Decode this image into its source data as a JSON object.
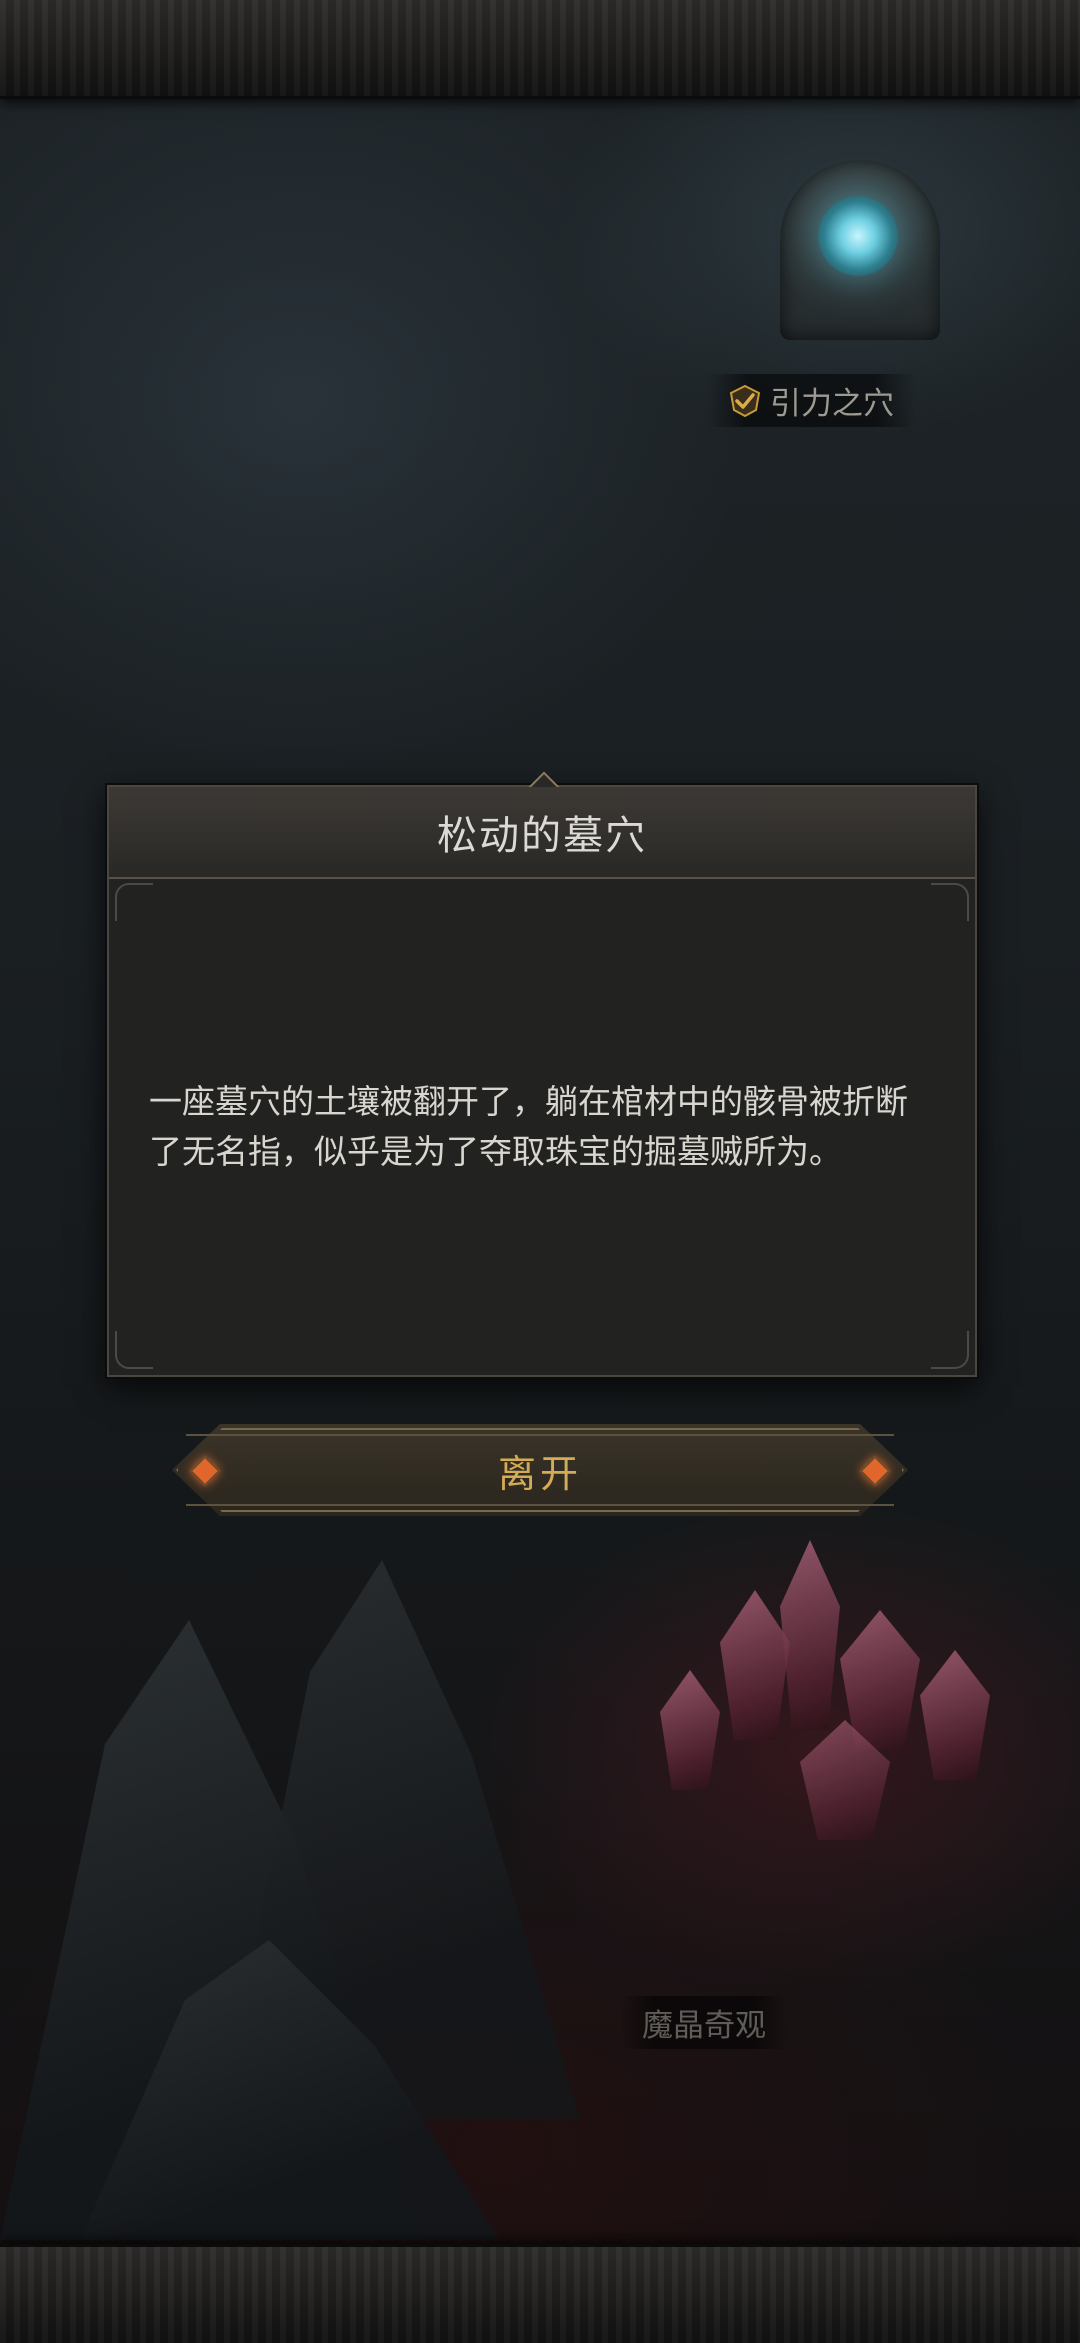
{
  "locations": {
    "gravity_hole": "引力之穴",
    "crystal_wonder": "魔晶奇观"
  },
  "dialog": {
    "title": "松动的墓穴",
    "body": "一座墓穴的土壤被翻开了，躺在棺材中的骸骨被折断了无名指，似乎是为了夺取珠宝的掘墓贼所为。"
  },
  "buttons": {
    "leave": "离开"
  },
  "colors": {
    "accent_gold": "#d4ab57",
    "check_gold": "#c99a3a",
    "gem_orange": "#e0662b"
  }
}
